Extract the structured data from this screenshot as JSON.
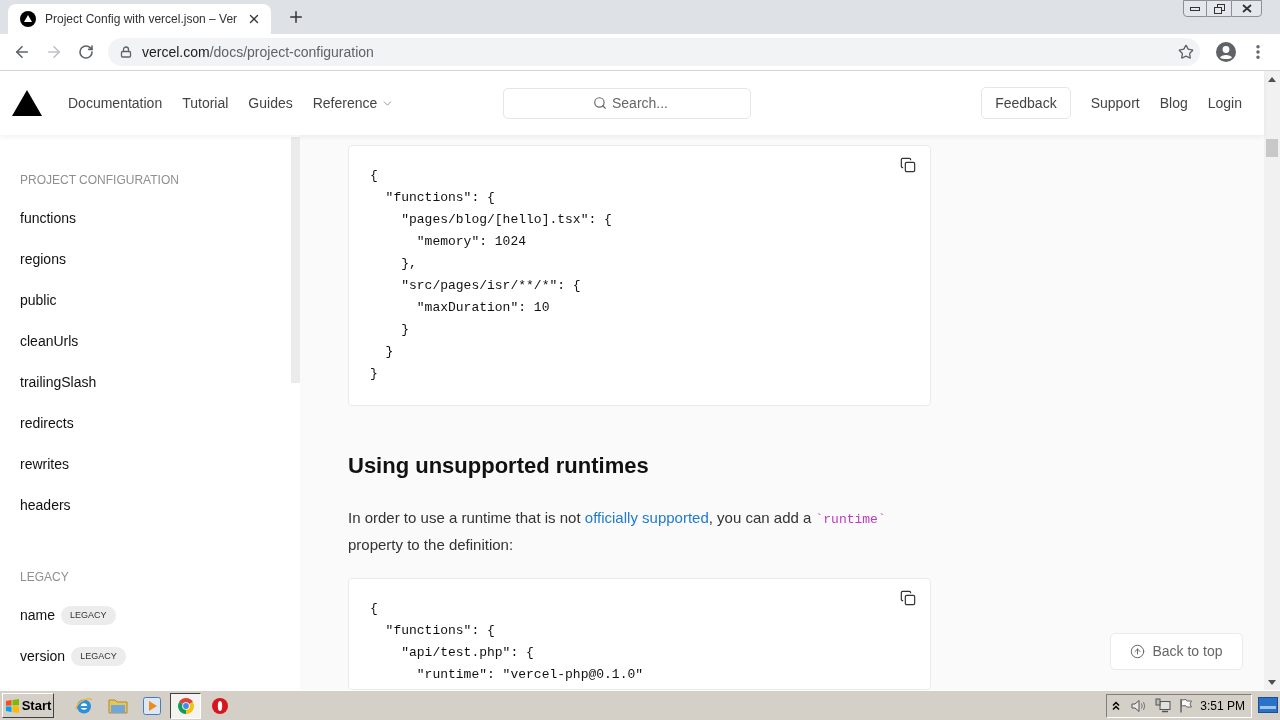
{
  "browser": {
    "tab": {
      "title": "Project Config with vercel.json – Ver",
      "selected": true
    },
    "nav_buttons": [
      {
        "kind": "back",
        "disabled": false
      },
      {
        "kind": "forward",
        "disabled": true
      },
      {
        "kind": "reload",
        "disabled": false
      }
    ],
    "address": {
      "host": "vercel.com",
      "path": "/docs/project-configuration"
    }
  },
  "site_nav": {
    "links": [
      {
        "label": "Documentation",
        "dropdown": false
      },
      {
        "label": "Tutorial",
        "dropdown": false
      },
      {
        "label": "Guides",
        "dropdown": false
      },
      {
        "label": "Reference",
        "dropdown": true
      }
    ],
    "search": {
      "placeholder": "Search..."
    },
    "actions": [
      {
        "kind": "button",
        "label": "Feedback"
      },
      {
        "kind": "link",
        "label": "Support"
      },
      {
        "kind": "link",
        "label": "Blog"
      },
      {
        "kind": "link",
        "label": "Login"
      }
    ]
  },
  "sidebar": {
    "sections": [
      {
        "title": "PROJECT CONFIGURATION",
        "items": [
          {
            "label": "functions"
          },
          {
            "label": "regions"
          },
          {
            "label": "public"
          },
          {
            "label": "cleanUrls"
          },
          {
            "label": "trailingSlash"
          },
          {
            "label": "redirects"
          },
          {
            "label": "rewrites"
          },
          {
            "label": "headers"
          }
        ]
      },
      {
        "title": "LEGACY",
        "items": [
          {
            "label": "name",
            "badge": "LEGACY"
          },
          {
            "label": "version",
            "badge": "LEGACY"
          }
        ]
      }
    ]
  },
  "content": {
    "blocks": [
      {
        "kind": "code",
        "code": "{\n  \"functions\": {\n    \"pages/blog/[hello].tsx\": {\n      \"memory\": 1024\n    },\n    \"src/pages/isr/**/*\": {\n      \"maxDuration\": 10\n    }\n  }\n}"
      },
      {
        "kind": "heading",
        "text": "Using unsupported runtimes"
      },
      {
        "kind": "paragraph",
        "parts": [
          {
            "kind": "text",
            "text": "In order to use a runtime that is not "
          },
          {
            "kind": "link",
            "text": "officially supported"
          },
          {
            "kind": "text",
            "text": ", you can add a "
          },
          {
            "kind": "code",
            "text": "`runtime`"
          },
          {
            "kind": "text",
            "text": " property to the definition:"
          }
        ]
      },
      {
        "kind": "code",
        "code": "{\n  \"functions\": {\n    \"api/test.php\": {\n      \"runtime\": \"vercel-php@0.1.0\""
      }
    ]
  },
  "back_to_top": {
    "label": "Back to top"
  },
  "taskbar": {
    "start_label": "Start",
    "apps": [
      {
        "kind": "globe",
        "selected": false
      },
      {
        "kind": "folder",
        "selected": false
      },
      {
        "kind": "player",
        "selected": false
      },
      {
        "kind": "browser",
        "selected": true
      },
      {
        "kind": "ring",
        "selected": false
      }
    ],
    "clock": "3:51 PM"
  }
}
